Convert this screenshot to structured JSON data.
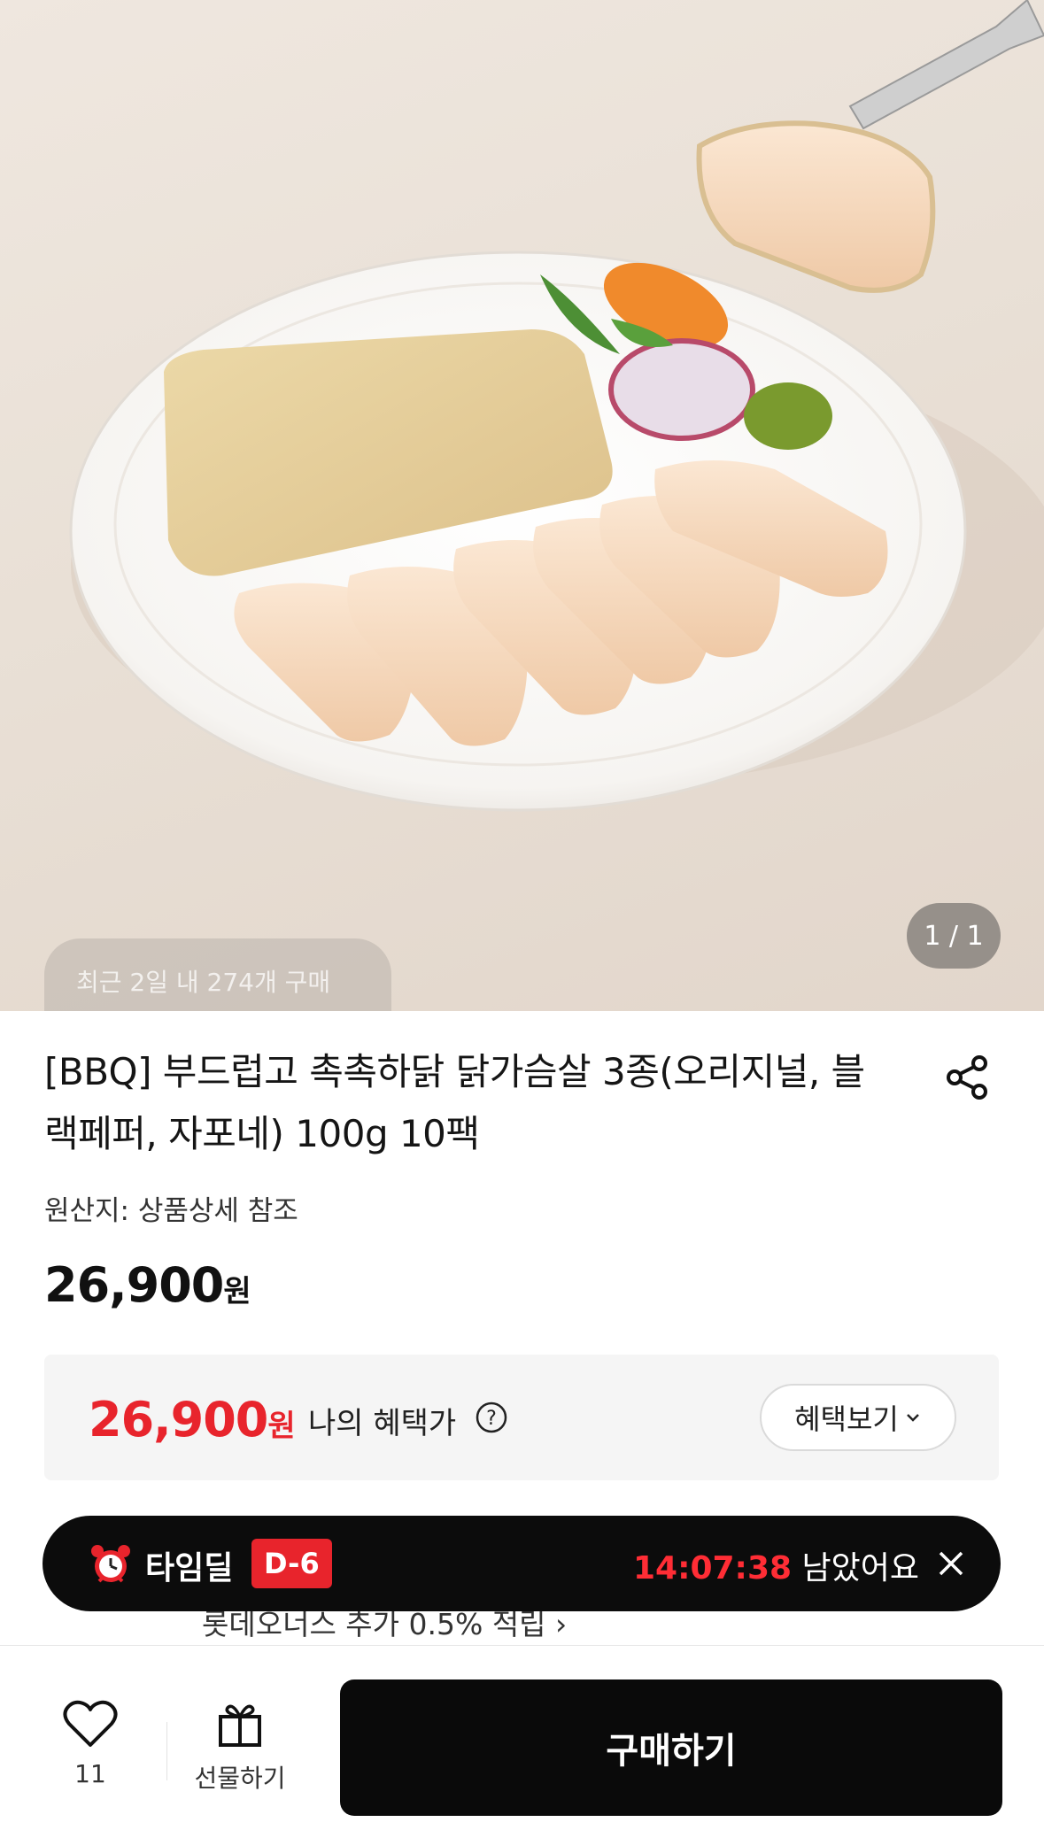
{
  "hero": {
    "recent_purchase_text": "최근 2일 내 274개 구매",
    "page_indicator": "1 / 1",
    "image_icon": "chicken-breast-plate-photo"
  },
  "product": {
    "title": "[BBQ] 부드럽고 촉촉하닭 닭가슴살 3종(오리지널, 블랙페퍼, 자포네) 100g 10팩",
    "origin": "원산지: 상품상세 참조",
    "price": "26,900",
    "currency": "원",
    "share_icon": "share-icon"
  },
  "benefit": {
    "price": "26,900",
    "currency": "원",
    "label": "나의 혜택가",
    "button_label": "혜택보기",
    "accent_color": "#e8242c"
  },
  "behind_banner_text": "롯데오너스 추가 0.5% 적립 ›",
  "timedeal": {
    "label": "타임딜",
    "dday": "D-6",
    "time": "14:07:38",
    "suffix": "남았어요",
    "icon": "alarm-clock-icon"
  },
  "bottom": {
    "like_count": "11",
    "gift_label": "선물하기",
    "buy_label": "구매하기"
  }
}
